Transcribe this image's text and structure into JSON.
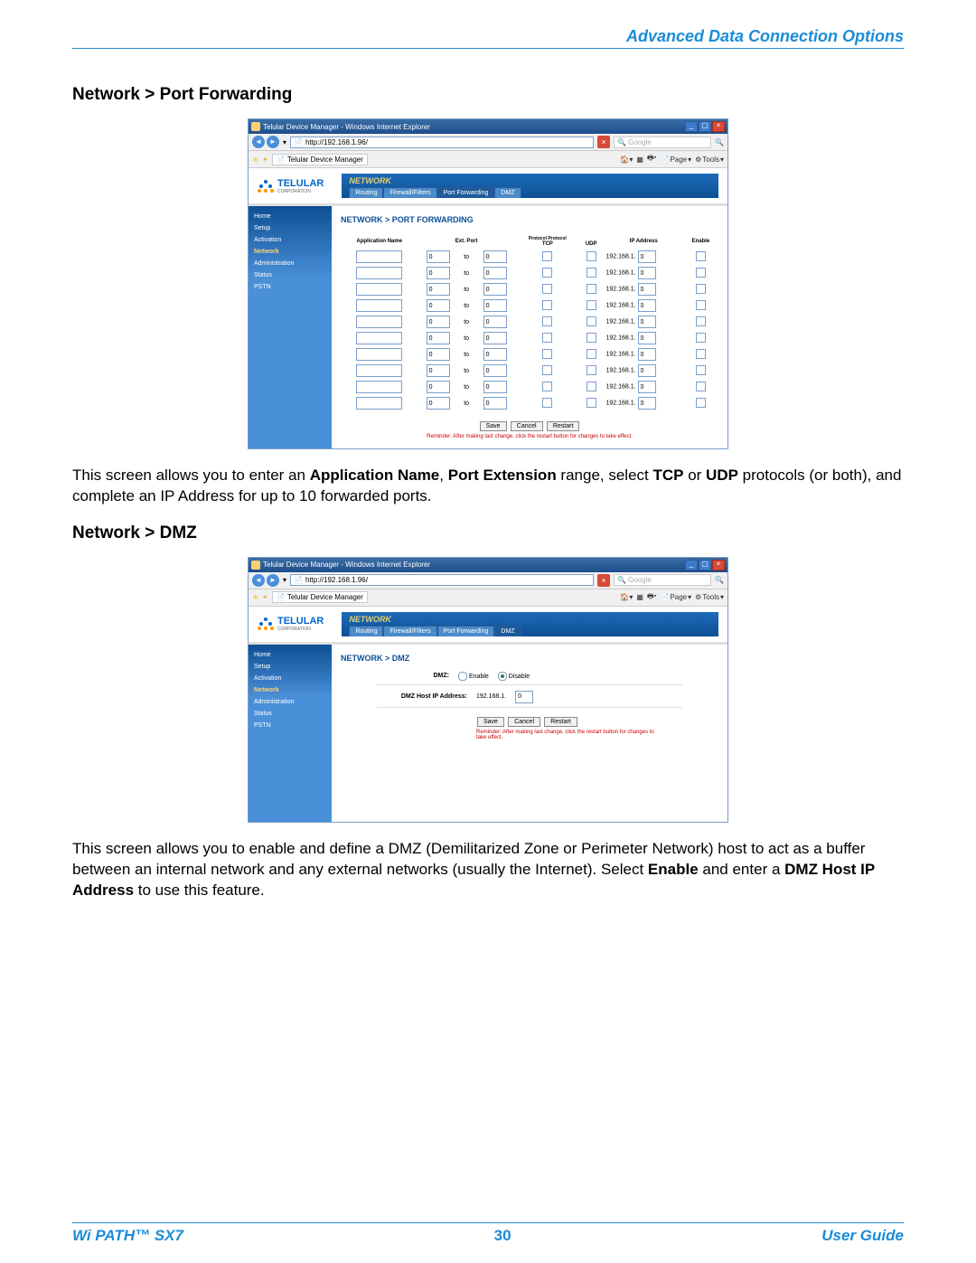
{
  "page_header": "Advanced Data Connection Options",
  "sections": {
    "pf": {
      "title": "Network > Port Forwarding",
      "para_parts": [
        "This screen allows you to enter an ",
        "Application Name",
        ", ",
        "Port Extension",
        " range, select ",
        "TCP",
        " or ",
        "UDP",
        " protocols (or both), and complete an IP Address for up to 10 forwarded ports."
      ]
    },
    "dmz": {
      "title": "Network > DMZ",
      "para_parts": [
        "This screen allows you to enable and define a DMZ (Demilitarized Zone or Perimeter Network) host to act as a buffer between an internal network and any external networks (usually the Internet). Select ",
        "Enable",
        " and enter a ",
        "DMZ Host IP Address",
        " to use this feature."
      ]
    }
  },
  "ie": {
    "title": "Telular Device Manager - Windows Internet Explorer",
    "url": "http://192.168.1.96/",
    "search_placeholder": "Google",
    "tab": "Telular Device Manager",
    "tools": {
      "page": "Page",
      "tools": "Tools"
    }
  },
  "telular": {
    "brand": "TELULAR",
    "brand_sub": "CORPORATION",
    "topnav_title": "NETWORK",
    "subtabs": [
      "Routing",
      "Firewall/Filters",
      "Port Forwarding",
      "DMZ"
    ],
    "sidebar": [
      "Home",
      "Setup",
      "Activation",
      "Network",
      "Administration",
      "Status",
      "PSTN"
    ]
  },
  "pf_panel": {
    "title": "NETWORK > PORT FORWARDING",
    "headers": {
      "app": "Application Name",
      "ext": "Ext. Port",
      "proto": "Protocol Protocol",
      "tcp": "TCP",
      "udp": "UDP",
      "ip": "IP Address",
      "enable": "Enable"
    },
    "row": {
      "port_from": "0",
      "to": "to",
      "port_to": "0",
      "ip_prefix": "192.168.1.",
      "ip_last": "0"
    },
    "row_count": 10,
    "buttons": {
      "save": "Save",
      "cancel": "Cancel",
      "restart": "Restart"
    },
    "reminder": "Reminder: After making last change, click the restart button for changes to take effect."
  },
  "dmz_panel": {
    "title": "NETWORK > DMZ",
    "dmz_label": "DMZ:",
    "enable": "Enable",
    "disable": "Disable",
    "host_label": "DMZ Host IP Address:",
    "ip_prefix": "192.168.1.",
    "ip_last": "0",
    "buttons": {
      "save": "Save",
      "cancel": "Cancel",
      "restart": "Restart"
    },
    "reminder": "Reminder: After making last change, click the restart button for changes to take effect."
  },
  "footer": {
    "left": "Wi PATH™ SX7",
    "center": "30",
    "right": "User Guide"
  }
}
